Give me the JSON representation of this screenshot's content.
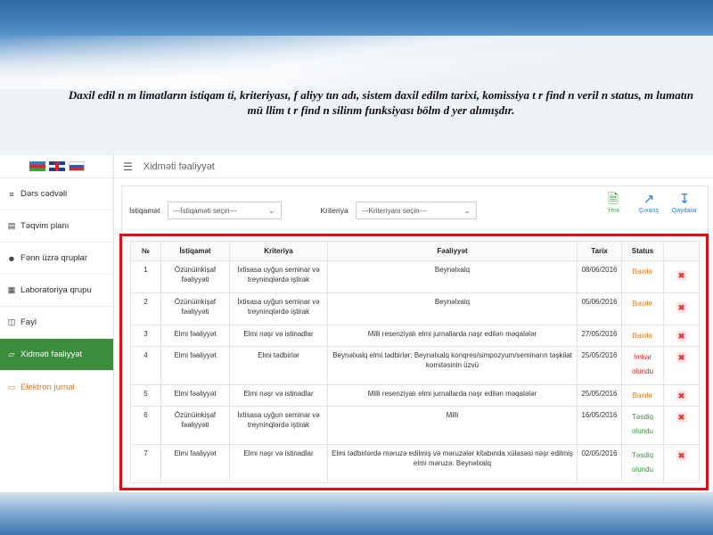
{
  "caption": "Daxil edil n m limatların istiqam ti, kriteriyası, f aliyy tın adı, sistem daxil edilm tarixi, komissiya t r find n veril n status, m lumatın mü llim t r find n silinm funksiyası bölm d yer alımışdır.",
  "sidebar": {
    "items": [
      {
        "label": "Dərs cədvəli",
        "icon": "list-icon"
      },
      {
        "label": "Təqvim planı",
        "icon": "calendar-icon"
      },
      {
        "label": "Fənn üzrə qruplar",
        "icon": "users-icon"
      },
      {
        "label": "Laboratoriya qrupu",
        "icon": "grid-icon"
      },
      {
        "label": "Fayl",
        "icon": "file-icon"
      },
      {
        "label": "Xidməti fəaliyyət",
        "icon": "chart-icon"
      },
      {
        "label": "Elektron jurnal",
        "icon": "book-icon"
      }
    ]
  },
  "topbar": {
    "title": "Xidməti fəaliyyət"
  },
  "filters": {
    "istiqamet_label": "İstiqamət",
    "istiqamet_value": "---İstiqaməti seçin---",
    "kriteriya_label": "Kriteriya",
    "kriteriya_value": "---Kriteriyanı seçin---"
  },
  "actions": {
    "new": "Yeni",
    "export": "Çıxarış",
    "saved": "Qaydalar"
  },
  "table": {
    "headers": [
      "№",
      "İstiqamət",
      "Kriteriya",
      "Fəaliyyət",
      "Tarix",
      "Status",
      ""
    ],
    "rows": [
      {
        "n": "1",
        "istiqamet": "Özünüinkişaf fəaliyyəti",
        "kriteriya": "İxtisasa uyğun seminar və treyninqlərdə iştirak",
        "fealiyyet": "Beynəlxalq",
        "tarix": "08/06/2016",
        "status": "Baxılır"
      },
      {
        "n": "2",
        "istiqamet": "Özünüinkişaf fəaliyyəti",
        "kriteriya": "İxtisasa uyğun seminar və treyninqlərdə iştirak",
        "fealiyyet": "Beynəlxalq",
        "tarix": "05/06/2016",
        "status": "Baxılır"
      },
      {
        "n": "3",
        "istiqamet": "Elmi fəaliyyət",
        "kriteriya": "Elmi nəşr və istinadlar",
        "fealiyyet": "Milli resenziyalı elmi jurnallarda nəşr edilən məqalələr",
        "tarix": "27/05/2016",
        "status": "Baxılır"
      },
      {
        "n": "4",
        "istiqamet": "Elmi fəaliyyət",
        "kriteriya": "Elmi tədbirlər",
        "fealiyyet": "Beynəlxalq elmi tədbirlər: Beynəlxalq konqres/simpozyum/seminarın təşkilat komitəsinin üzvü",
        "tarix": "25/05/2016",
        "status": "İmkar olundu"
      },
      {
        "n": "5",
        "istiqamet": "Elmi fəaliyyət",
        "kriteriya": "Elmi nəşr və istinadlar",
        "fealiyyet": "Milli resenziyalı elmi jurnallarda nəşr edilən məqalələr",
        "tarix": "25/05/2016",
        "status": "Baxılır"
      },
      {
        "n": "6",
        "istiqamet": "Özünüinkişaf fəaliyyəti",
        "kriteriya": "İxtisasa uyğun seminar və treyninqlərdə iştirak",
        "fealiyyet": "Milli",
        "tarix": "16/05/2016",
        "status": "Təsdiq olundu"
      },
      {
        "n": "7",
        "istiqamet": "Elmi fəaliyyət",
        "kriteriya": "Elmi nəşr və istinadlar",
        "fealiyyet": "Elmi tədbirlərdə məruzə edilmiş və məruzələr kitabında xülasəsi nəşr edilmiş elmi məruzə: Beynəlxalq",
        "tarix": "02/05/2016",
        "status": "Təsdiq olundu"
      }
    ]
  },
  "colors": {
    "active_nav": "#3b8c3b",
    "highlight_frame": "#e0101a",
    "pending": "#e07a1f",
    "rejected": "#d61e1e",
    "approved": "#2f9a2f"
  }
}
